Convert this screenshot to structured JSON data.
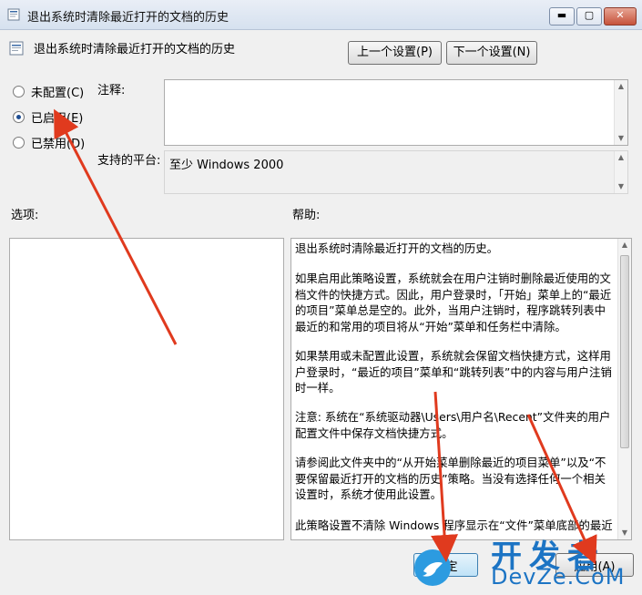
{
  "window": {
    "title": "退出系统时清除最近打开的文档的历史",
    "controls": {
      "minimize": "▬",
      "maximize": "▢",
      "close": "✕"
    }
  },
  "header": {
    "policy_name": "退出系统时清除最近打开的文档的历史",
    "prev_button": "上一个设置(P)",
    "next_button": "下一个设置(N)"
  },
  "state": {
    "options": [
      {
        "label": "未配置(C)",
        "checked": false
      },
      {
        "label": "已启用(E)",
        "checked": true
      },
      {
        "label": "已禁用(D)",
        "checked": false
      }
    ]
  },
  "fields": {
    "comment_label": "注释:",
    "platform_label": "支持的平台:",
    "platform_value": "至少 Windows 2000",
    "options_label": "选项:",
    "help_label": "帮助:"
  },
  "help": {
    "paragraphs": [
      "退出系统时清除最近打开的文档的历史。",
      "如果启用此策略设置，系统就会在用户注销时删除最近使用的文档文件的快捷方式。因此，用户登录时，「开始」菜单上的“最近的项目”菜单总是空的。此外，当用户注销时，程序跳转列表中最近的和常用的项目将从“开始”菜单和任务栏中清除。",
      "如果禁用或未配置此设置，系统就会保留文档快捷方式，这样用户登录时，“最近的项目”菜单和“跳转列表”中的内容与用户注销时一样。",
      "注意: 系统在“系统驱动器\\Users\\用户名\\Recent”文件夹的用户配置文件中保存文档快捷方式。",
      "请参阅此文件夹中的“从开始菜单删除最近的项目菜单”以及“不要保留最近打开的文档的历史”策略。当没有选择任何一个相关设置时，系统才使用此设置。",
      "此策略设置不清除 Windows 程序显示在“文件”菜单底部的最近"
    ]
  },
  "footer": {
    "ok_button": "确定",
    "apply_button": "应用(A)"
  },
  "watermark": {
    "cn": "开发者",
    "en": "DevZe.CoM"
  },
  "colors": {
    "arrow": "#e03a1e",
    "watermark": "#1c74c4"
  }
}
